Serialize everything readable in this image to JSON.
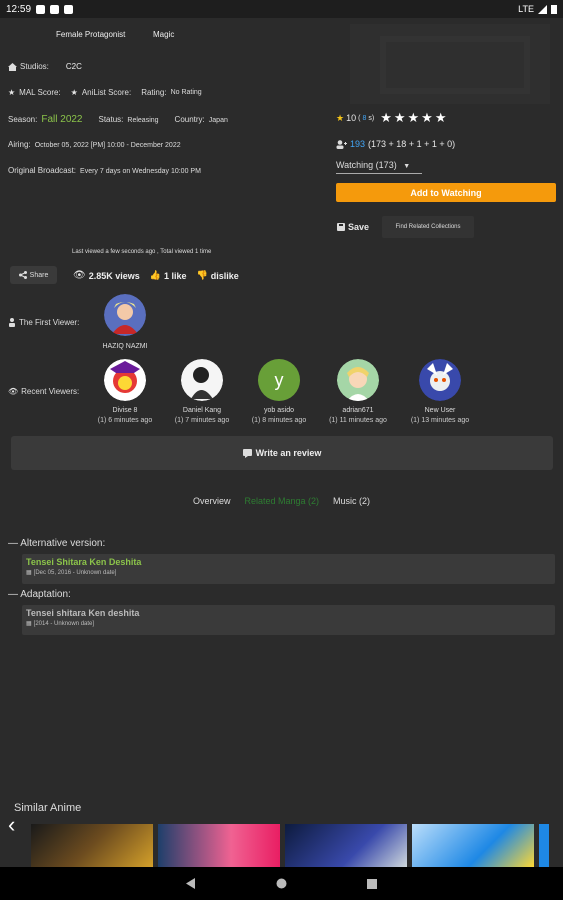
{
  "status_bar": {
    "time": "12:59",
    "network": "LTE"
  },
  "tags": [
    "Female Protagonist",
    "Magic"
  ],
  "info": {
    "studios_label": "Studios:",
    "studios_value": "C2C",
    "mal_label": "MAL Score:",
    "anilist_label": "AniList Score:",
    "rating_label": "Rating:",
    "rating_value": "No Rating",
    "season_label": "Season:",
    "season_value": "Fall 2022",
    "status_label": "Status:",
    "status_value": "Releasing",
    "country_label": "Country:",
    "country_value": "Japan",
    "airing_label": "Airing:",
    "airing_value": "October 05, 2022 [PM] 10:00 - December 2022",
    "broadcast_label": "Original Broadcast:",
    "broadcast_value": "Every 7 days on Wednesday 10:00 PM"
  },
  "score": {
    "prefix": "10",
    "paren": "(",
    "count": "8",
    "suffix": "s)"
  },
  "members": {
    "count": "193",
    "breakdown": "(173 + 18 + 1 + 1 + 0)"
  },
  "watching_select": "Watching (173)",
  "add_button": "Add to Watching",
  "save_label": "Save",
  "related_collections": "Find Related Collections",
  "last_viewed": "Last viewed a few seconds ago , Total viewed 1 time",
  "share_label": "Share",
  "views": "2.85K views",
  "likes": "1 like",
  "dislike": "dislike",
  "first_viewer_label": "The First Viewer:",
  "first_viewer_name": "HAZIQ NAZMI",
  "recent_viewers_label": "Recent Viewers:",
  "recent_viewers": [
    {
      "name": "Divise 8",
      "time": "(1) 6 minutes ago",
      "initial": ""
    },
    {
      "name": "Daniel Kang",
      "time": "(1) 7 minutes ago",
      "initial": ""
    },
    {
      "name": "yob asido",
      "time": "(1) 8 minutes ago",
      "initial": "y"
    },
    {
      "name": "adrian671",
      "time": "(1) 11 minutes ago",
      "initial": ""
    },
    {
      "name": "New User",
      "time": "(1) 13 minutes ago",
      "initial": ""
    }
  ],
  "review_button": "Write an review",
  "tabs": [
    "Overview",
    "Related Manga (2)",
    "Music (2)"
  ],
  "alt_version_label": "Alternative version:",
  "alt_version": {
    "title": "Tensei Shitara Ken Deshita",
    "date": "[Dec 05, 2016 - Unknown date]"
  },
  "adaptation_label": "Adaptation:",
  "adaptation": {
    "title": "Tensei shitara Ken deshita",
    "date": "[2014 - Unknown date]"
  },
  "similar_title": "Similar Anime",
  "colors": {
    "accent": "#f59a0c",
    "green": "#8bc34a",
    "tab_active": "#2e7d32",
    "link": "#42a5f5"
  }
}
